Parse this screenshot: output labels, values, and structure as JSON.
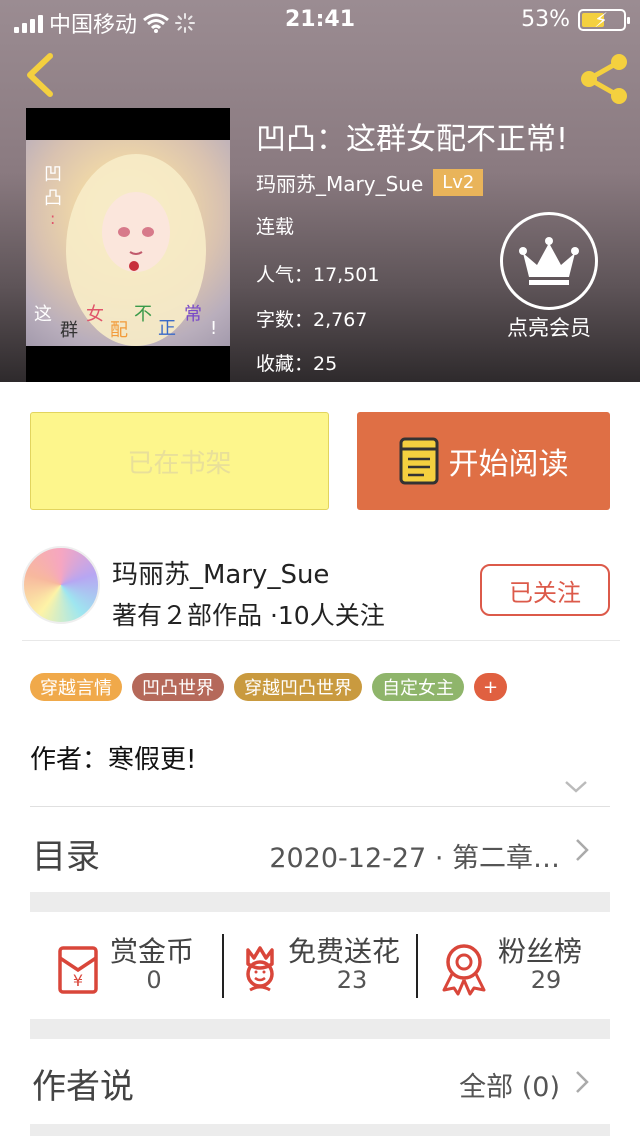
{
  "status_bar": {
    "carrier": "中国移动",
    "time": "21:41",
    "battery": "53%",
    "battery_level": 0.53
  },
  "book": {
    "title": "凹凸：这群女配不正常!",
    "author": "玛丽苏_Mary_Sue",
    "level": "Lv2",
    "status": "连载",
    "popularity": "人气：17,501",
    "word_count": "字数：2,767",
    "favorites": "收藏：25",
    "cover_lettering": "凹凸：这群女配不正常!"
  },
  "vip": {
    "label": "点亮会员"
  },
  "buttons": {
    "shelf": "已在书架",
    "read": "开始阅读"
  },
  "author_card": {
    "name": "玛丽苏_Mary_Sue",
    "stats": "著有２部作品 ·10人关注",
    "follow": "已关注"
  },
  "tags": [
    {
      "label": "穿越言情",
      "color": "#f0a94a"
    },
    {
      "label": "凹凸世界",
      "color": "#b5695a"
    },
    {
      "label": "穿越凹凸世界",
      "color": "#c99a3f"
    },
    {
      "label": "自定女主",
      "color": "#8fb56b"
    }
  ],
  "tag_more": "+",
  "intro": "作者：寒假更!",
  "toc": {
    "label": "目录",
    "latest": "2020-12-27 · 第二章…"
  },
  "actions": {
    "reward": {
      "label": "赏金币",
      "count": "0"
    },
    "flowers": {
      "label": "免费送花",
      "count": "23"
    },
    "fans": {
      "label": "粉丝榜",
      "count": "29"
    }
  },
  "author_says": {
    "label": "作者说",
    "all": "全部 (0)"
  },
  "colors": {
    "read_button": "#df6f45",
    "shelf_button": "#fdf68c",
    "follow": "#dc5a4a",
    "level_badge": "#e9b45a"
  }
}
